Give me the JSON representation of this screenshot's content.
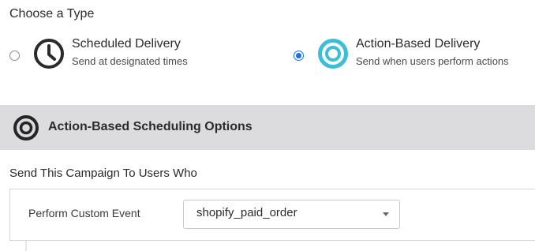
{
  "header": {
    "title": "Choose a Type"
  },
  "delivery_types": [
    {
      "title": "Scheduled Delivery",
      "description": "Send at designated times",
      "selected": false,
      "icon": "clock-icon"
    },
    {
      "title": "Action-Based Delivery",
      "description": "Send when users perform actions",
      "selected": true,
      "icon": "target-icon"
    }
  ],
  "options_section": {
    "title": "Action-Based Scheduling Options",
    "icon": "target-icon"
  },
  "send_section": {
    "label": "Send This Campaign To Users Who",
    "trigger_label": "Perform Custom Event",
    "selected_event": "shopify_paid_order"
  },
  "colors": {
    "accent": "#1a6fe8",
    "target_icon": "#3bbfd8",
    "bar_background": "#dcdcde"
  }
}
